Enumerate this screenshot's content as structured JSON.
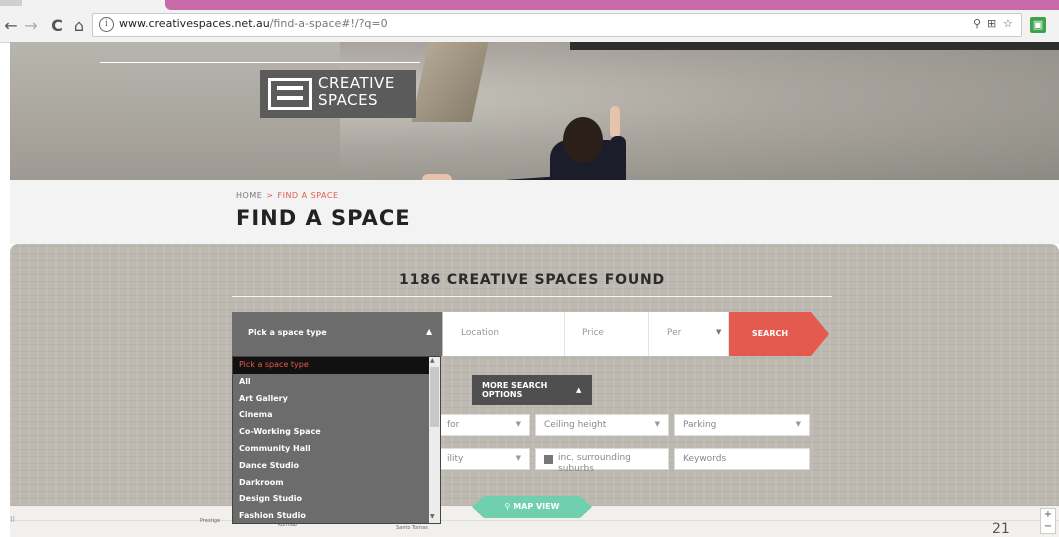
{
  "browser": {
    "url_domain": "www.creativespaces.net.au",
    "url_path": "/find-a-space#!/?q=0",
    "back_icon": "←",
    "forward_icon": "→",
    "reload_icon": "C",
    "home_icon": "⌂",
    "info_icon": "i",
    "zoom_icon": "⚲",
    "translate_icon": "⊞",
    "star_icon": "☆",
    "extension_icon": "▣"
  },
  "logo": {
    "line1": "CREATIVE",
    "line2": "SPACES"
  },
  "breadcrumb": {
    "home": "HOME",
    "separator": ">",
    "current": "FIND A SPACE"
  },
  "page_title": "FIND A SPACE",
  "search": {
    "results_count": "1186 CREATIVE SPACES FOUND",
    "space_type_label": "Pick a space type",
    "space_type_caret": "▲",
    "location_placeholder": "Location",
    "price_placeholder": "Price",
    "per_label": "Per",
    "per_caret": "▼",
    "search_button": "SEARCH",
    "more_options_line1": "MORE SEARCH",
    "more_options_line2": "OPTIONS",
    "more_options_caret": "▲",
    "filters": {
      "for_label": "for",
      "ceiling_label": "Ceiling height",
      "parking_label": "Parking",
      "ability_label": "ility",
      "suburbs_label": "inc. surrounding suburbs",
      "keywords_placeholder": "Keywords",
      "caret": "▼"
    },
    "map_view_label": "MAP VIEW",
    "map_view_icon": "⚲"
  },
  "dropdown": {
    "items": [
      "Pick a space type",
      "All",
      "Art Gallery",
      "Cinema",
      "Co-Working Space",
      "Community Hall",
      "Dance Studio",
      "Darkroom",
      "Design Studio",
      "Fashion Studio"
    ],
    "scroll_up": "▲",
    "scroll_down": "▼"
  },
  "map": {
    "labels": [
      "Prestige",
      "Kurnlab",
      "Santo Tomas"
    ],
    "zoom_plus": "+",
    "zoom_minus": "−",
    "handle": "⁝⁝"
  },
  "slide_number": "21",
  "colors": {
    "accent": "#e55a4e",
    "map_button": "#6fcfae",
    "tab_strip": "#c76aa7"
  }
}
